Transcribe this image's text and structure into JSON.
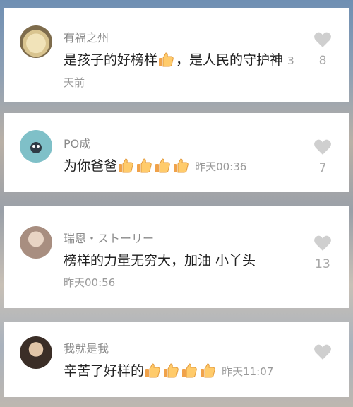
{
  "comments": [
    {
      "username": "有福之州",
      "text": "是孩子的好榜样",
      "after_emoji": "，是人民的守护神",
      "time": "3天前",
      "likes": "8",
      "emoji": [
        "thumbs-up"
      ]
    },
    {
      "username": "PO成",
      "text": "为你爸爸",
      "time": "昨天00:36",
      "likes": "7",
      "emoji": [
        "thumbs-up",
        "thumbs-up",
        "thumbs-up",
        "thumbs-up"
      ]
    },
    {
      "username": "瑞恩・ストーリー",
      "text": "榜样的力量无穷大，加油 小丫头",
      "time": "昨天00:56",
      "likes": "13",
      "emoji": []
    },
    {
      "username": "我就是我",
      "text": "辛苦了好样的",
      "time": "昨天11:07",
      "likes": "",
      "emoji": [
        "thumbs-up",
        "thumbs-up",
        "thumbs-up",
        "thumbs-up"
      ]
    }
  ],
  "colors": {
    "text": "#222222",
    "meta": "#8a8a8a",
    "like_icon": "#cfcfcf"
  }
}
